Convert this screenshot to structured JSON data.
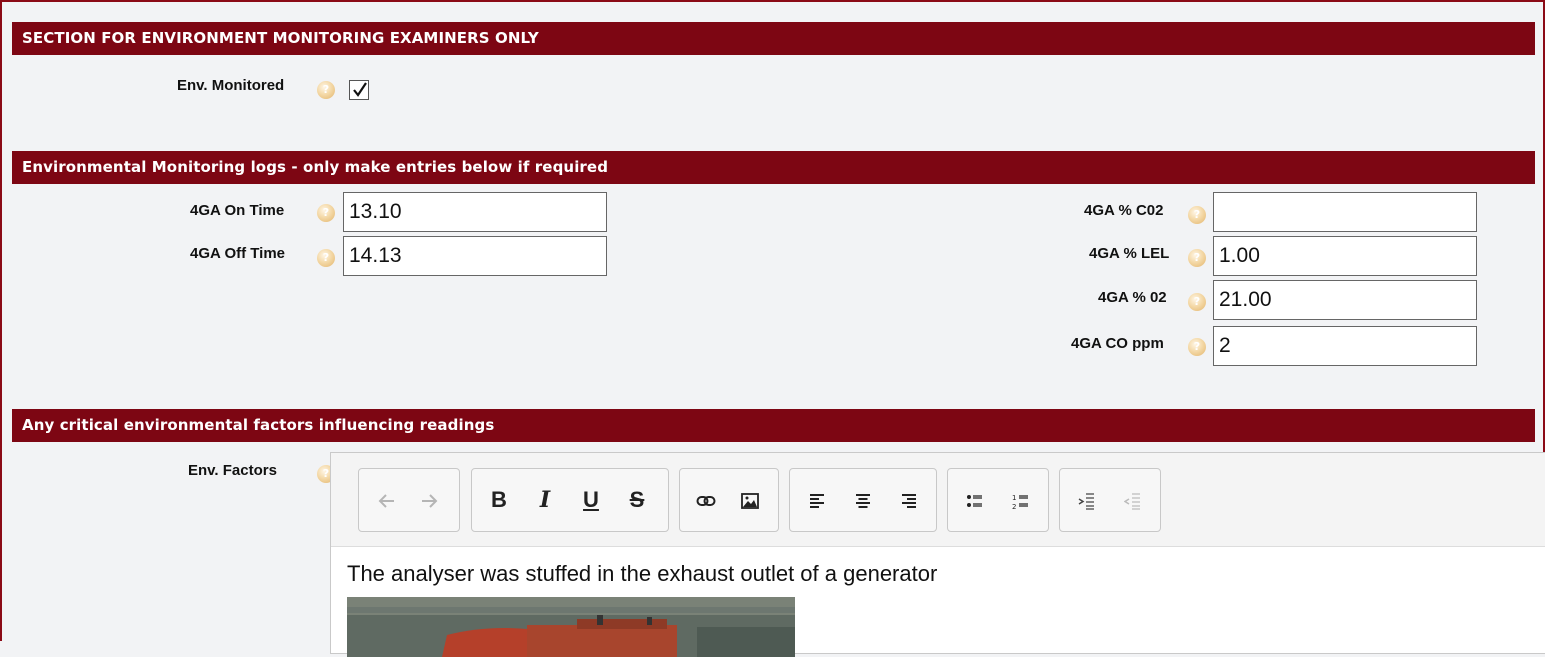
{
  "sections": {
    "examiners": {
      "title": "SECTION FOR ENVIRONMENT MONITORING EXAMINERS ONLY"
    },
    "logs": {
      "title": "Environmental Monitoring logs - only make entries below if required"
    },
    "factors": {
      "title": "Any critical environmental factors influencing readings"
    }
  },
  "env_monitored": {
    "label": "Env. Monitored",
    "checked": true
  },
  "fields": {
    "on_time": {
      "label": "4GA On Time",
      "value": "13.10"
    },
    "off_time": {
      "label": "4GA Off Time",
      "value": "14.13"
    },
    "co2": {
      "label": "4GA % C02",
      "value": ""
    },
    "lel": {
      "label": "4GA % LEL",
      "value": "1.00"
    },
    "o2": {
      "label": "4GA % 02",
      "value": "21.00"
    },
    "co": {
      "label": "4GA CO ppm",
      "value": "2"
    }
  },
  "env_factors": {
    "label": "Env. Factors",
    "text": "The analyser was stuffed in the exhaust outlet of a generator"
  },
  "toolbar": {
    "bold": "B",
    "italic": "I",
    "underline": "U",
    "strike": "S"
  },
  "icons": {
    "help": "help-icon",
    "undo": "undo-icon",
    "redo": "redo-icon",
    "link": "link-icon",
    "image": "image-icon",
    "align_left": "align-left-icon",
    "align_center": "align-center-icon",
    "align_right": "align-right-icon",
    "bullet_list": "bullet-list-icon",
    "numbered_list": "numbered-list-icon",
    "indent": "indent-icon",
    "outdent": "outdent-icon"
  },
  "colors": {
    "header": "#7d0613",
    "border": "#8b0a16"
  }
}
